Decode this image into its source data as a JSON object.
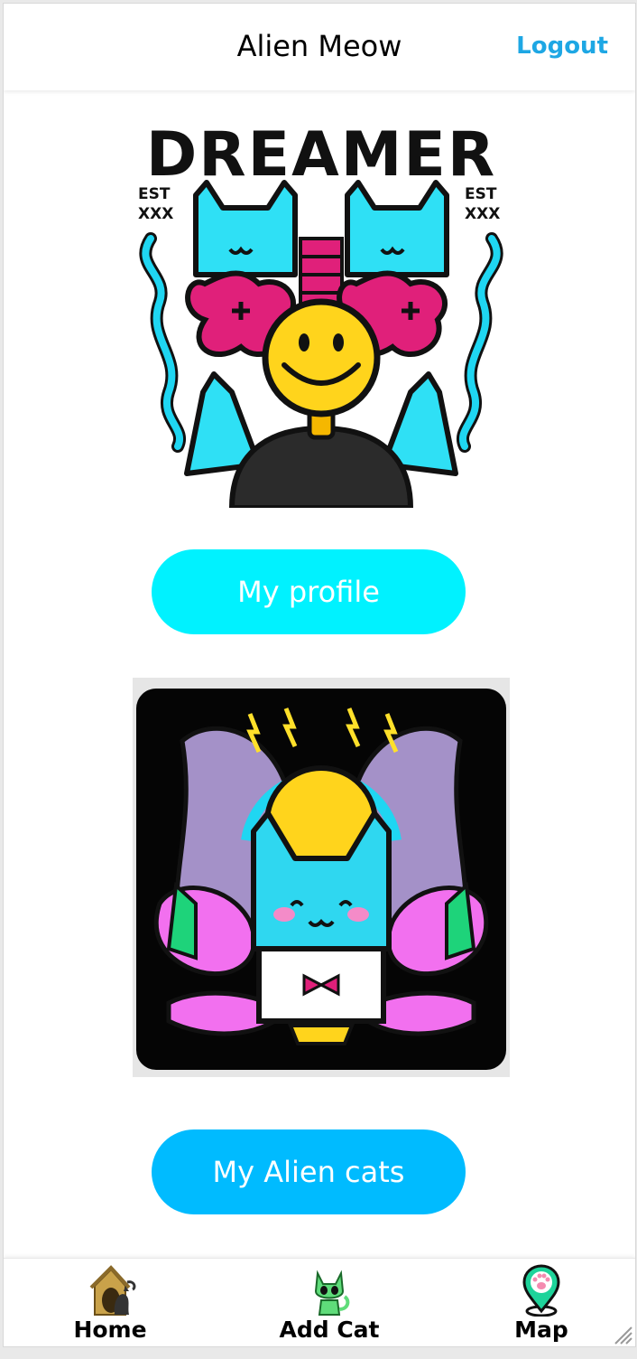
{
  "header": {
    "title": "Alien Meow",
    "logout_label": "Logout"
  },
  "artwork_1": {
    "text_top": "DREAMER",
    "text_left": "EST",
    "text_left_sub": "XXX",
    "text_right": "EST",
    "text_right_sub": "XXX"
  },
  "buttons": {
    "profile_label": "My profile",
    "cats_label": "My Alien cats"
  },
  "nav": {
    "items": [
      {
        "label": "Home",
        "icon": "cat-house-icon"
      },
      {
        "label": "Add Cat",
        "icon": "alien-cat-icon"
      },
      {
        "label": "Map",
        "icon": "paw-map-pin-icon"
      }
    ]
  },
  "colors": {
    "accent_cyan": "#00f2ff",
    "accent_blue": "#00bbff",
    "logout_blue": "#1ea7e4"
  }
}
